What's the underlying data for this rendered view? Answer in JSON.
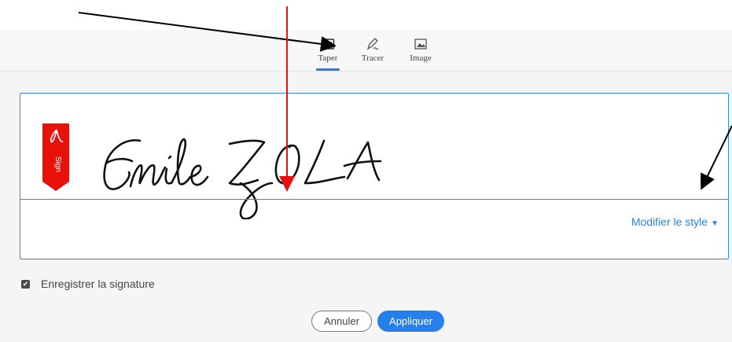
{
  "tabs": [
    {
      "label": "Taper",
      "icon": "keyboard-icon",
      "active": true
    },
    {
      "label": "Tracer",
      "icon": "pen-icon",
      "active": false
    },
    {
      "label": "Image",
      "icon": "image-icon",
      "active": false
    }
  ],
  "canvas": {
    "signature_text": "Emile ZOLA",
    "modify_style_label": "Modifier le style",
    "sign_badge_label": "Sign"
  },
  "save": {
    "label": "Enregistrer la signature",
    "checked": true
  },
  "buttons": {
    "cancel_label": "Annuler",
    "apply_label": "Appliquer"
  },
  "colors": {
    "accent": "#2680eb",
    "badge": "#e8120b",
    "annotation_arrow_red": "#e51212",
    "annotation_arrow_black": "#000000"
  }
}
